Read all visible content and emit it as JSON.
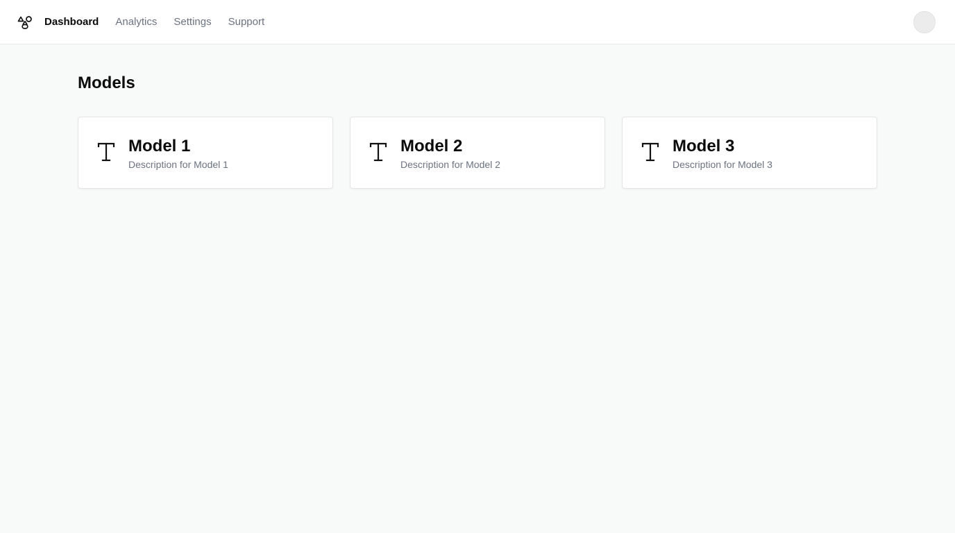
{
  "header": {
    "logo_icon": "biohazard-like-logo-icon",
    "nav": [
      {
        "label": "Dashboard",
        "active": true
      },
      {
        "label": "Analytics",
        "active": false
      },
      {
        "label": "Settings",
        "active": false
      },
      {
        "label": "Support",
        "active": false
      }
    ],
    "avatar": "user-avatar"
  },
  "main": {
    "title": "Models",
    "cards": [
      {
        "icon": "text-type-icon",
        "title": "Model 1",
        "description": "Description for Model 1"
      },
      {
        "icon": "text-type-icon",
        "title": "Model 2",
        "description": "Description for Model 2"
      },
      {
        "icon": "text-type-icon",
        "title": "Model 3",
        "description": "Description for Model 3"
      }
    ]
  },
  "colors": {
    "background": "#f8f9f9",
    "surface": "#ffffff",
    "text_primary": "#0b0b0b",
    "text_muted": "#6b7280",
    "border": "#e3e6e8"
  }
}
